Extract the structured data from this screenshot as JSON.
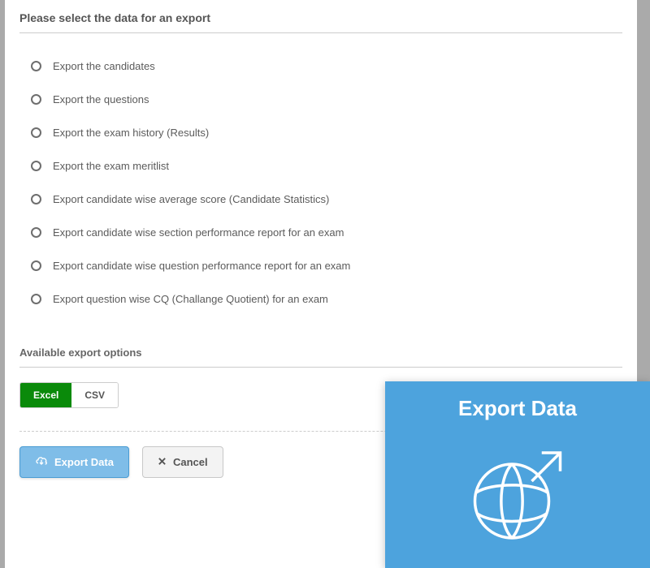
{
  "panel": {
    "title": "Please select the data for an export",
    "options": [
      "Export the candidates",
      "Export the questions",
      "Export the exam history (Results)",
      "Export the exam meritlist",
      "Export candidate wise average score (Candidate Statistics)",
      "Export candidate wise section performance report for an exam",
      "Export candidate wise question performance report for an exam",
      "Export question wise CQ (Challange Quotient) for an exam"
    ],
    "formats_title": "Available export options",
    "formats": {
      "excel": "Excel",
      "csv": "CSV"
    },
    "actions": {
      "export": "Export Data",
      "cancel": "Cancel"
    }
  },
  "overlay": {
    "title": "Export Data"
  }
}
